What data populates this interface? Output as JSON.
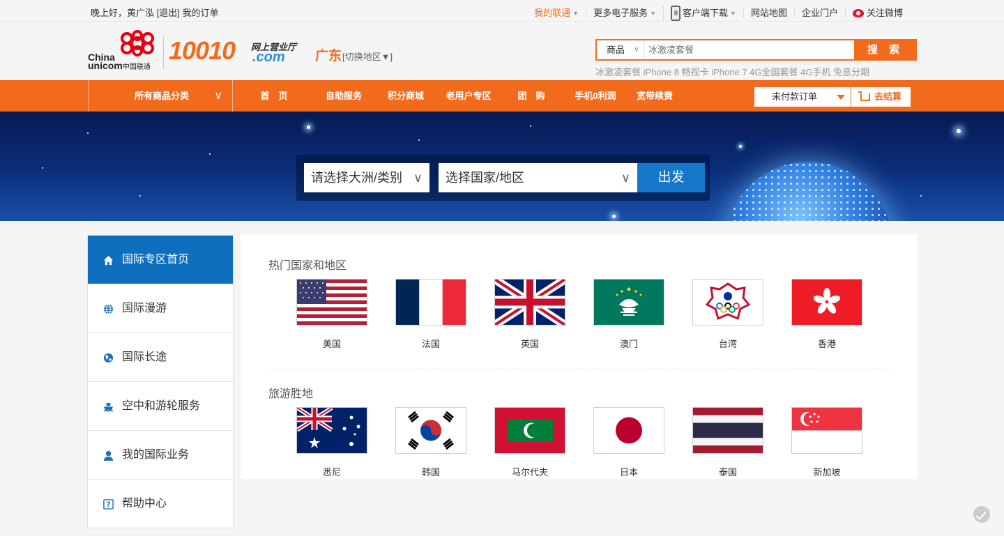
{
  "topbar": {
    "greeting": "晚上好，黄广泓",
    "logout": "[退出]",
    "my_orders": "我的订单",
    "my_unicom": "我的联通",
    "more_services": "更多电子服务",
    "client_download": "客户端下载",
    "site_map": "网站地图",
    "enterprise": "企业门户",
    "weibo": "关注微博"
  },
  "header": {
    "logo_en_1": "China",
    "logo_en_2": "unicom",
    "logo_cn": "中国联通",
    "logo_10010": "10010",
    "logo_sub_cn": "网上营业厅",
    "logo_sub_com": ".com",
    "region": "广东",
    "region_switch": "[切换地区▼]",
    "search_category": "商品",
    "search_placeholder": "冰激凌套餐",
    "search_button": "搜 索",
    "hot_words": [
      "冰激凌套餐",
      "iPhone 8",
      "畅视卡",
      "iPhone 7",
      "4G全国套餐",
      "4G手机",
      "免息分期"
    ]
  },
  "nav": {
    "all_categories": "所有商品分类",
    "items": [
      "首　页",
      "自助服务",
      "积分商城",
      "老用户专区",
      "团　购",
      "手机0利润",
      "宽带续费"
    ],
    "unpaid_orders": "未付款订单",
    "checkout": "去结算"
  },
  "banner": {
    "continent_select": "请选择大洲/类别",
    "country_select": "选择国家/地区",
    "go_button": "出发"
  },
  "sidebar": {
    "items": [
      {
        "label": "国际专区首页",
        "icon": "home-icon"
      },
      {
        "label": "国际漫游",
        "icon": "globe-icon"
      },
      {
        "label": "国际长途",
        "icon": "earth-icon"
      },
      {
        "label": "空中和游轮服务",
        "icon": "ship-icon"
      },
      {
        "label": "我的国际业务",
        "icon": "user-icon"
      },
      {
        "label": "帮助中心",
        "icon": "help-icon"
      }
    ]
  },
  "content": {
    "hot_title": "热门国家和地区",
    "hot_countries": [
      "美国",
      "法国",
      "英国",
      "澳门",
      "台湾",
      "香港"
    ],
    "travel_title": "旅游胜地",
    "travel_countries": [
      "悉尼",
      "韩国",
      "马尔代夫",
      "日本",
      "泰国",
      "新加坡"
    ]
  },
  "colors": {
    "brand_orange": "#f26b1d",
    "nav_blue": "#0e6fbe",
    "go_blue": "#1677c8"
  }
}
